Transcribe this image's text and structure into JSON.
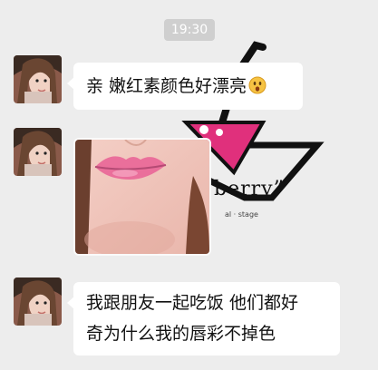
{
  "chat": {
    "timestamp": "19:30",
    "background_watermark": {
      "brand_text": "berry”",
      "sub_text": "al · stage"
    },
    "messages": [
      {
        "type": "text",
        "text": "亲 嫩红素颜色好漂亮",
        "emoji": "surprised-face"
      },
      {
        "type": "image",
        "image": "lips-photo"
      },
      {
        "type": "text",
        "lines": [
          "我跟朋友一起吃饭 他们都好",
          "奇为什么我的唇彩不掉色"
        ]
      }
    ]
  },
  "colors": {
    "chat_background": "#ededed",
    "bubble_background": "#ffffff",
    "timestamp_background": "#cfcfcf",
    "watermark_pink": "#e0307c"
  }
}
